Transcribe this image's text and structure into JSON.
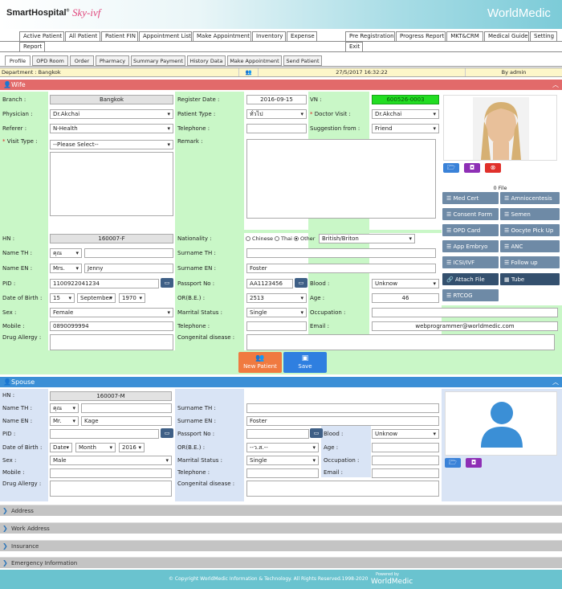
{
  "app": {
    "logo": "SmartHospital",
    "logo_reg": "®",
    "logo_sub": "Sky-ivf",
    "brand": "WorldMedic"
  },
  "nav": {
    "tabs": [
      "Active Patient",
      "All Patient",
      "Patient FIN",
      "Appointment List",
      "Make Appointment",
      "Inventory",
      "Expense",
      "Report"
    ],
    "right_tabs": [
      "Pre Registration",
      "Progress Report",
      "MKT&CRM",
      "Medical Guide",
      "Setting",
      "Exit"
    ],
    "subtabs": [
      "Profile",
      "OPD Room",
      "Order",
      "Pharmacy",
      "Summary Payment",
      "History Data",
      "Make Appointment",
      "Send Patient"
    ]
  },
  "dept": {
    "department": "Department : Bangkok",
    "datetime": "27/5/2017 16:32:22",
    "user": "By admin"
  },
  "wife": {
    "title": "Wife",
    "labels": {
      "branch": "Branch :",
      "register_date": "Register Date :",
      "vn": "VN :",
      "physician": "Physician :",
      "patient_type": "Patient Type :",
      "doctor_visit": "Doctor Visit :",
      "referer": "Referer :",
      "telephone": "Telephone :",
      "suggestion": "Suggestion from :",
      "visit_type": "Visit Type :",
      "remark": "Remark :",
      "hn": "HN :",
      "nationality": "Nationality :",
      "name_th": "Name TH :",
      "surname_th": "Surname TH :",
      "name_en": "Name EN :",
      "surname_en": "Surname EN :",
      "pid": "PID :",
      "passport": "Passport No :",
      "blood": "Blood :",
      "dob": "Date of Birth :",
      "or_be": "OR(B.E.) :",
      "age": "Age :",
      "sex": "Sex :",
      "marital": "Marrital Status :",
      "occupation": "Occupation :",
      "mobile": "Mobile :",
      "telephone2": "Telephone :",
      "email": "Email :",
      "drug_allergy": "Drug Allergy :",
      "congenital": "Congenital disease :"
    },
    "values": {
      "branch": "Bangkok",
      "register_date": "2016-09-15",
      "vn": "600526-0003",
      "physician": "Dr.Akchai",
      "patient_type": "ทั่วไป",
      "doctor_visit": "Dr.Akchai",
      "referer": "N-Health",
      "suggestion": "Friend",
      "visit_type": "--Please Select--",
      "hn": "160007-F",
      "nat_chinese": "Chinese",
      "nat_thai": "Thai",
      "nat_other": "Other",
      "nationality": "British/Briton",
      "name_th_prefix": "คุณ",
      "name_en_prefix": "Mrs.",
      "name_en": "Jenny",
      "surname_en": "Foster",
      "pid": "1100922041234",
      "passport": "AA1123456",
      "blood": "Unknow",
      "dob_day": "15",
      "dob_month": "September",
      "dob_year": "1970",
      "or_be": "2513",
      "age": "46",
      "sex": "Female",
      "marital": "Single",
      "mobile": "0890099994",
      "email": "webprogrammer@worldmedic.com"
    },
    "file_count": "0 File",
    "docs": [
      "Med Cert",
      "Amniocentesis",
      "Consent Form",
      "Semen",
      "OPD Card",
      "Oocyte Pick Up",
      "App Embryo",
      "ANC",
      "ICSI/IVF",
      "Follow up",
      "Attach File",
      "Tube",
      "RTCOG"
    ],
    "buttons": {
      "new_patient": "New Patient",
      "save": "Save"
    }
  },
  "spouse": {
    "title": "Spouse",
    "labels": {
      "hn": "HN :",
      "name_th": "Name TH :",
      "surname_th": "Surname TH :",
      "name_en": "Name EN :",
      "surname_en": "Surname EN :",
      "pid": "PID :",
      "passport": "Passport No :",
      "blood": "Blood :",
      "dob": "Date of Birth :",
      "or_be": "OR(B.E.) :",
      "age": "Age :",
      "sex": "Sex :",
      "marital": "Marrital Status :",
      "occupation": "Occupation :",
      "mobile": "Mobile :",
      "telephone": "Telephone :",
      "email": "Email :",
      "drug_allergy": "Drug Allergy :",
      "congenital": "Congenital disease :"
    },
    "values": {
      "hn": "160007-M",
      "name_th_prefix": "คุณ",
      "name_en_prefix": "Mr.",
      "name_en": "Kage",
      "surname_en": "Foster",
      "blood": "Unknow",
      "dob_day": "Date",
      "dob_month": "Month",
      "dob_year": "2016",
      "or_be": "--ว.ส.--",
      "sex": "Male",
      "marital": "Single"
    }
  },
  "collapsed": [
    "Address",
    "Work Address",
    "Insurance",
    "Emergency Information"
  ],
  "footer": {
    "copyright": "© Copyright WorldMedic Information & Technology. All Rights Reserved.1998-2020",
    "powered": "Powered by",
    "brand": "WorldMedic"
  },
  "colors": {
    "wife_header": "#e26a6a",
    "spouse_header": "#3b8fd6",
    "green_bg": "#c9f7c7",
    "blue_bg": "#d9e4f5",
    "new_patient": "#f07a40",
    "save": "#2f7fe0"
  }
}
